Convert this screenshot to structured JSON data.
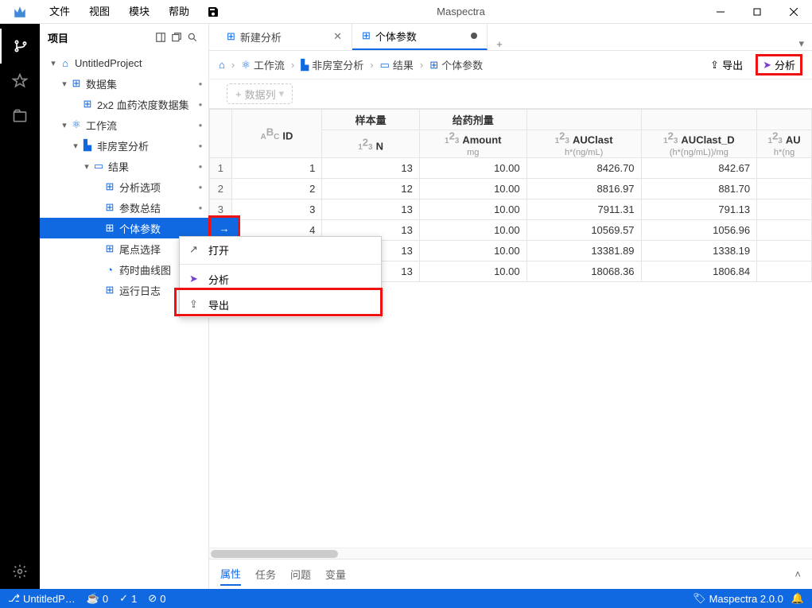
{
  "app": {
    "title": "Maspectra"
  },
  "menu": [
    "文件",
    "视图",
    "模块",
    "帮助"
  ],
  "sidebar": {
    "title": "项目",
    "tree": {
      "project": "UntitledProject",
      "dataset_group": "数据集",
      "dataset_item": "2x2 血药浓度数据集",
      "workflow_group": "工作流",
      "nca": "非房室分析",
      "results_group": "结果",
      "items": [
        "分析选项",
        "参数总结",
        "个体参数",
        "尾点选择",
        "药时曲线图",
        "运行日志"
      ]
    }
  },
  "ctx": {
    "open": "打开",
    "analyze": "分析",
    "export": "导出"
  },
  "tabs": {
    "t1": "新建分析",
    "t2": "个体参数"
  },
  "crumbs": {
    "workflow": "工作流",
    "nca": "非房室分析",
    "results": "结果",
    "indiv": "个体参数",
    "export": "导出",
    "analyze": "分析"
  },
  "toolbar": {
    "addcol": "数据列"
  },
  "table": {
    "headers": {
      "id": "ID",
      "n_top": "样本量",
      "n": "N",
      "amt_top": "给药剂量",
      "amt": "Amount",
      "amt_u": "mg",
      "auclast": "AUClast",
      "auclast_u": "h*(ng/mL)",
      "auclast_d": "AUClast_D",
      "auclast_d_u": "(h*(ng/mL))/mg",
      "au_more": "AU",
      "au_more_u": "h*(ng"
    },
    "rows": [
      {
        "id": "1",
        "n": "13",
        "amt": "10.00",
        "auclast": "8426.70",
        "auclast_d": "842.67"
      },
      {
        "id": "2",
        "n": "12",
        "amt": "10.00",
        "auclast": "8816.97",
        "auclast_d": "881.70"
      },
      {
        "id": "3",
        "n": "13",
        "amt": "10.00",
        "auclast": "7911.31",
        "auclast_d": "791.13"
      },
      {
        "id": "4",
        "n": "13",
        "amt": "10.00",
        "auclast": "10569.57",
        "auclast_d": "1056.96"
      },
      {
        "id": "",
        "n": "13",
        "amt": "10.00",
        "auclast": "13381.89",
        "auclast_d": "1338.19"
      },
      {
        "id": "",
        "n": "13",
        "amt": "10.00",
        "auclast": "18068.36",
        "auclast_d": "1806.84"
      }
    ]
  },
  "bottom": {
    "tabs": [
      "属性",
      "任务",
      "问题",
      "变量"
    ]
  },
  "status": {
    "project": "UntitledP…",
    "v1": "0",
    "v2": "1",
    "v3": "0",
    "brand": "Maspectra 2.0.0"
  }
}
